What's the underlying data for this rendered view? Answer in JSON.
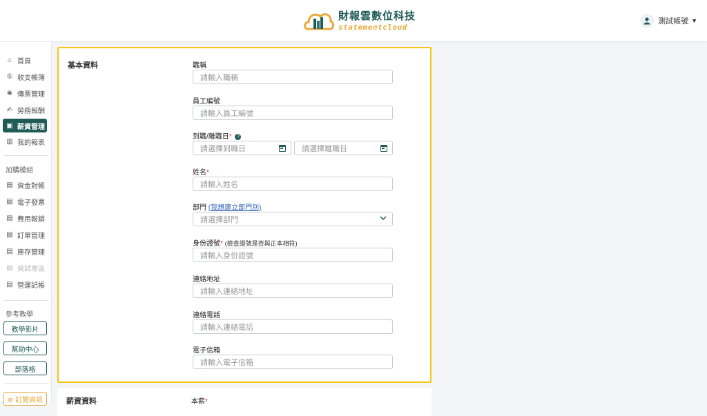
{
  "header": {
    "brand_name": "財報雲數位科技",
    "brand_sub": "statementcloud",
    "user_name": "測試帳號",
    "user_caret": "▼",
    "colors": {
      "brand_green": "#1f5b57",
      "brand_orange": "#e8a93a",
      "highlight": "#f5c518"
    }
  },
  "sidebar": {
    "main_items": [
      {
        "icon": "⌂",
        "label": "首頁"
      },
      {
        "icon": "⑤",
        "label": "收支帳簿"
      },
      {
        "icon": "❀",
        "label": "傳票管理"
      },
      {
        "icon": "✍",
        "label": "勞務報酬"
      },
      {
        "icon": "▣",
        "label": "薪資管理"
      },
      {
        "icon": "▥",
        "label": "我的報表"
      }
    ],
    "addon_label": "加購模組",
    "addon_items": [
      {
        "icon": "▤",
        "label": "資金對帳"
      },
      {
        "icon": "▤",
        "label": "電子發票"
      },
      {
        "icon": "▤",
        "label": "費用報銷"
      },
      {
        "icon": "▤",
        "label": "訂單管理"
      },
      {
        "icon": "▤",
        "label": "庫存管理"
      },
      {
        "icon": "▤",
        "label": "資試專區"
      },
      {
        "icon": "▤",
        "label": "營運記帳"
      }
    ],
    "ref_label": "參考教學",
    "ref_buttons": [
      "教學影片",
      "幫助中心",
      "部落格"
    ],
    "subscribe_label": "⊕ 訂閱資訊"
  },
  "form": {
    "section_title": "基本資料",
    "fields": {
      "title_label": "職稱",
      "title_placeholder": "請輸入職稱",
      "empno_label": "員工編號",
      "empno_placeholder": "請輸入員工編號",
      "date_label": "到職/離職日",
      "date_req": "*",
      "help_glyph": "?",
      "hire_placeholder": "請選擇到職日",
      "leave_placeholder": "請選擇離職日",
      "name_label": "姓名",
      "name_req": "*",
      "name_placeholder": "請輸入姓名",
      "dept_label": "部門",
      "dept_link": "(我想建立部門別)",
      "dept_placeholder": "請選擇部門",
      "dept_chevron": "⌄",
      "id_label": "身份證號",
      "id_req": "*",
      "id_hint": "(檢查證號是否與正本相符)",
      "id_placeholder": "請輸入身份證號",
      "addr_label": "連絡地址",
      "addr_placeholder": "請輸入連絡地址",
      "phone_label": "連絡電話",
      "phone_placeholder": "請輸入連絡電話",
      "email_label": "電子信箱",
      "email_placeholder": "請輸入電子信箱"
    }
  },
  "salary": {
    "section_title": "薪資資料",
    "first_field": "本薪",
    "first_req": "*"
  }
}
